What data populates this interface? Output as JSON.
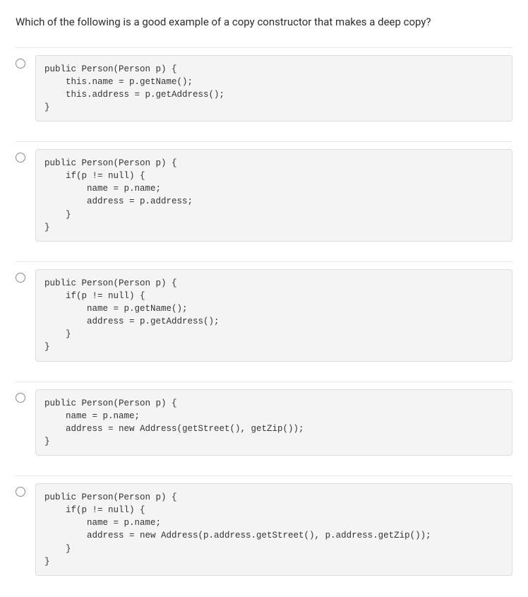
{
  "question": "Which of the following is a good example of a copy constructor that makes a deep copy?",
  "options": [
    {
      "code": "public Person(Person p) {\n    this.name = p.getName();\n    this.address = p.getAddress();\n}"
    },
    {
      "code": "public Person(Person p) {\n    if(p != null) {\n        name = p.name;\n        address = p.address;\n    }\n}"
    },
    {
      "code": "public Person(Person p) {\n    if(p != null) {\n        name = p.getName();\n        address = p.getAddress();\n    }\n}"
    },
    {
      "code": "public Person(Person p) {\n    name = p.name;\n    address = new Address(getStreet(), getZip());\n}"
    },
    {
      "code": "public Person(Person p) {\n    if(p != null) {\n        name = p.name;\n        address = new Address(p.address.getStreet(), p.address.getZip());\n    }\n}"
    }
  ]
}
